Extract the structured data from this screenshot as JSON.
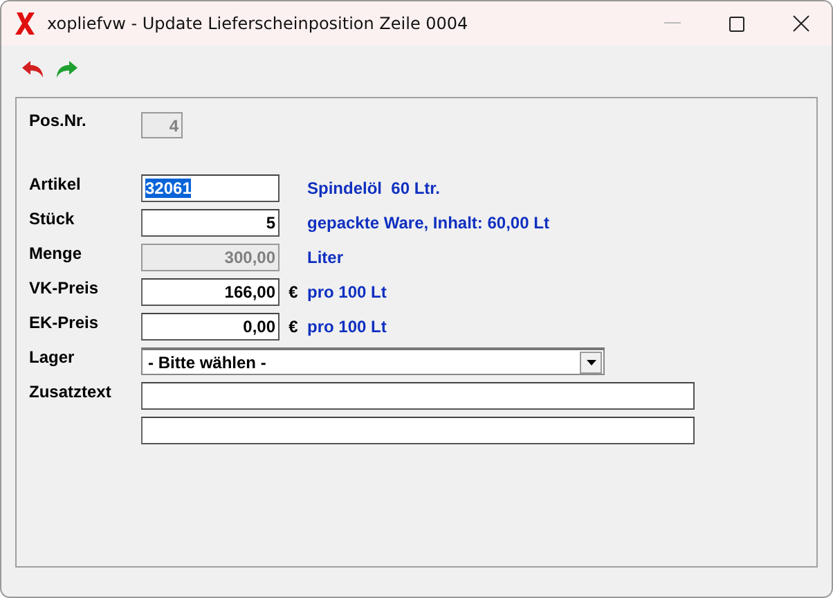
{
  "window": {
    "title": "xopliefvw - Update Lieferscheinposition Zeile 0004"
  },
  "toolbar": [
    {
      "kind": "undo"
    },
    {
      "kind": "redo"
    }
  ],
  "pos": {
    "label": "Pos.Nr.",
    "value": "4",
    "disabled": true
  },
  "rows": [
    {
      "kind": "text",
      "label": "Artikel",
      "value": "32061",
      "highlighted": true,
      "disabled": false,
      "note": "Spindelöl  60 Ltr."
    },
    {
      "kind": "number",
      "label": "Stück",
      "value": "5",
      "highlighted": false,
      "disabled": false,
      "note": "gepackte Ware, Inhalt: 60,00 Lt"
    },
    {
      "kind": "number",
      "label": "Menge",
      "value": "300,00",
      "highlighted": false,
      "disabled": true,
      "note": "Liter"
    },
    {
      "kind": "number",
      "label": "VK-Preis",
      "value": "166,00",
      "highlighted": false,
      "disabled": false,
      "unit": "€",
      "note": "pro 100 Lt"
    },
    {
      "kind": "number",
      "label": "EK-Preis",
      "value": "0,00",
      "highlighted": false,
      "disabled": false,
      "unit": "€",
      "note": "pro 100 Lt"
    },
    {
      "kind": "combo",
      "label": "Lager",
      "value": "- Bitte wählen -"
    },
    {
      "kind": "wide",
      "label": "Zusatztext"
    },
    {
      "kind": "wide"
    }
  ]
}
